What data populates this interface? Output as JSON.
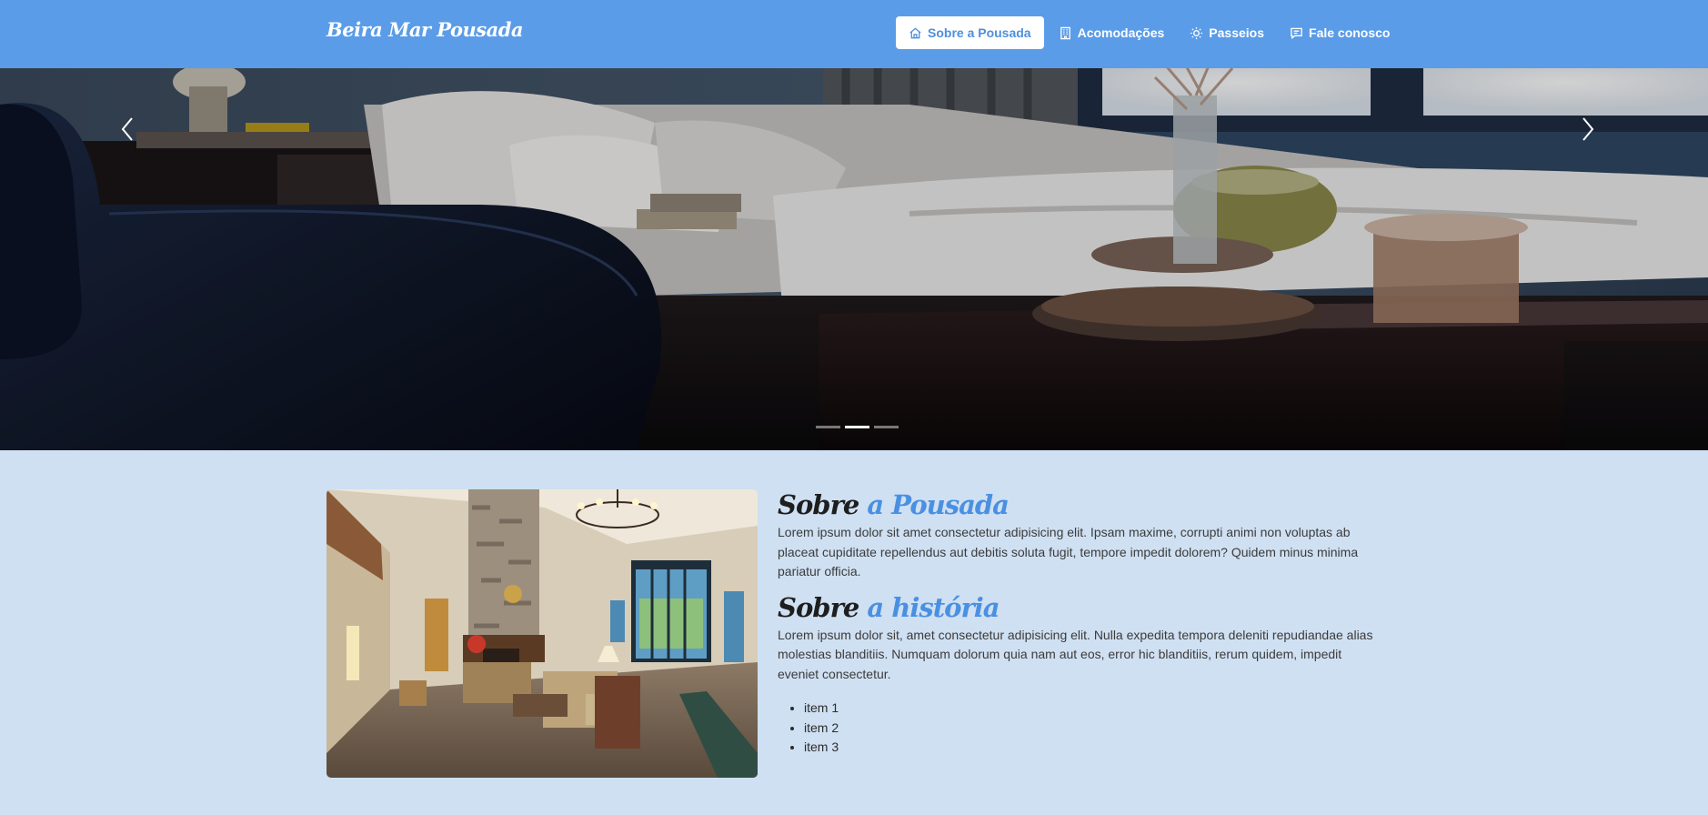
{
  "brand": "Beira Mar Pousada",
  "nav": {
    "items": [
      {
        "label": "Sobre a Pousada",
        "icon": "home-icon",
        "active": true
      },
      {
        "label": "Acomodações",
        "icon": "building-icon",
        "active": false
      },
      {
        "label": "Passeios",
        "icon": "sun-icon",
        "active": false
      },
      {
        "label": "Fale conosco",
        "icon": "chat-icon",
        "active": false
      }
    ]
  },
  "carousel": {
    "slide_count": 3,
    "active_slide": 2,
    "prev_icon": "chevron-left-icon",
    "next_icon": "chevron-right-icon"
  },
  "about": {
    "heading_main": "Sobre",
    "heading_accent": "a Pousada",
    "paragraph": "Lorem ipsum dolor sit amet consectetur adipisicing elit. Ipsam maxime, corrupti animi non voluptas ab placeat cupiditate repellendus aut debitis soluta fugit, tempore impedit dolorem? Quidem minus minima pariatur officia."
  },
  "history": {
    "heading_main": "Sobre",
    "heading_accent": "a história",
    "paragraph": "Lorem ipsum dolor sit, amet consectetur adipisicing elit. Nulla expedita tempora deleniti repudiandae alias molestias blanditiis. Numquam dolorum quia nam aut eos, error hic blanditiis, rerum quidem, impedit eveniet consectetur.",
    "items": [
      "item 1",
      "item 2",
      "item 3"
    ]
  },
  "colors": {
    "navbar": "#5b9ce8",
    "page_bg": "#cfe0f2",
    "accent": "#4a90e2"
  }
}
